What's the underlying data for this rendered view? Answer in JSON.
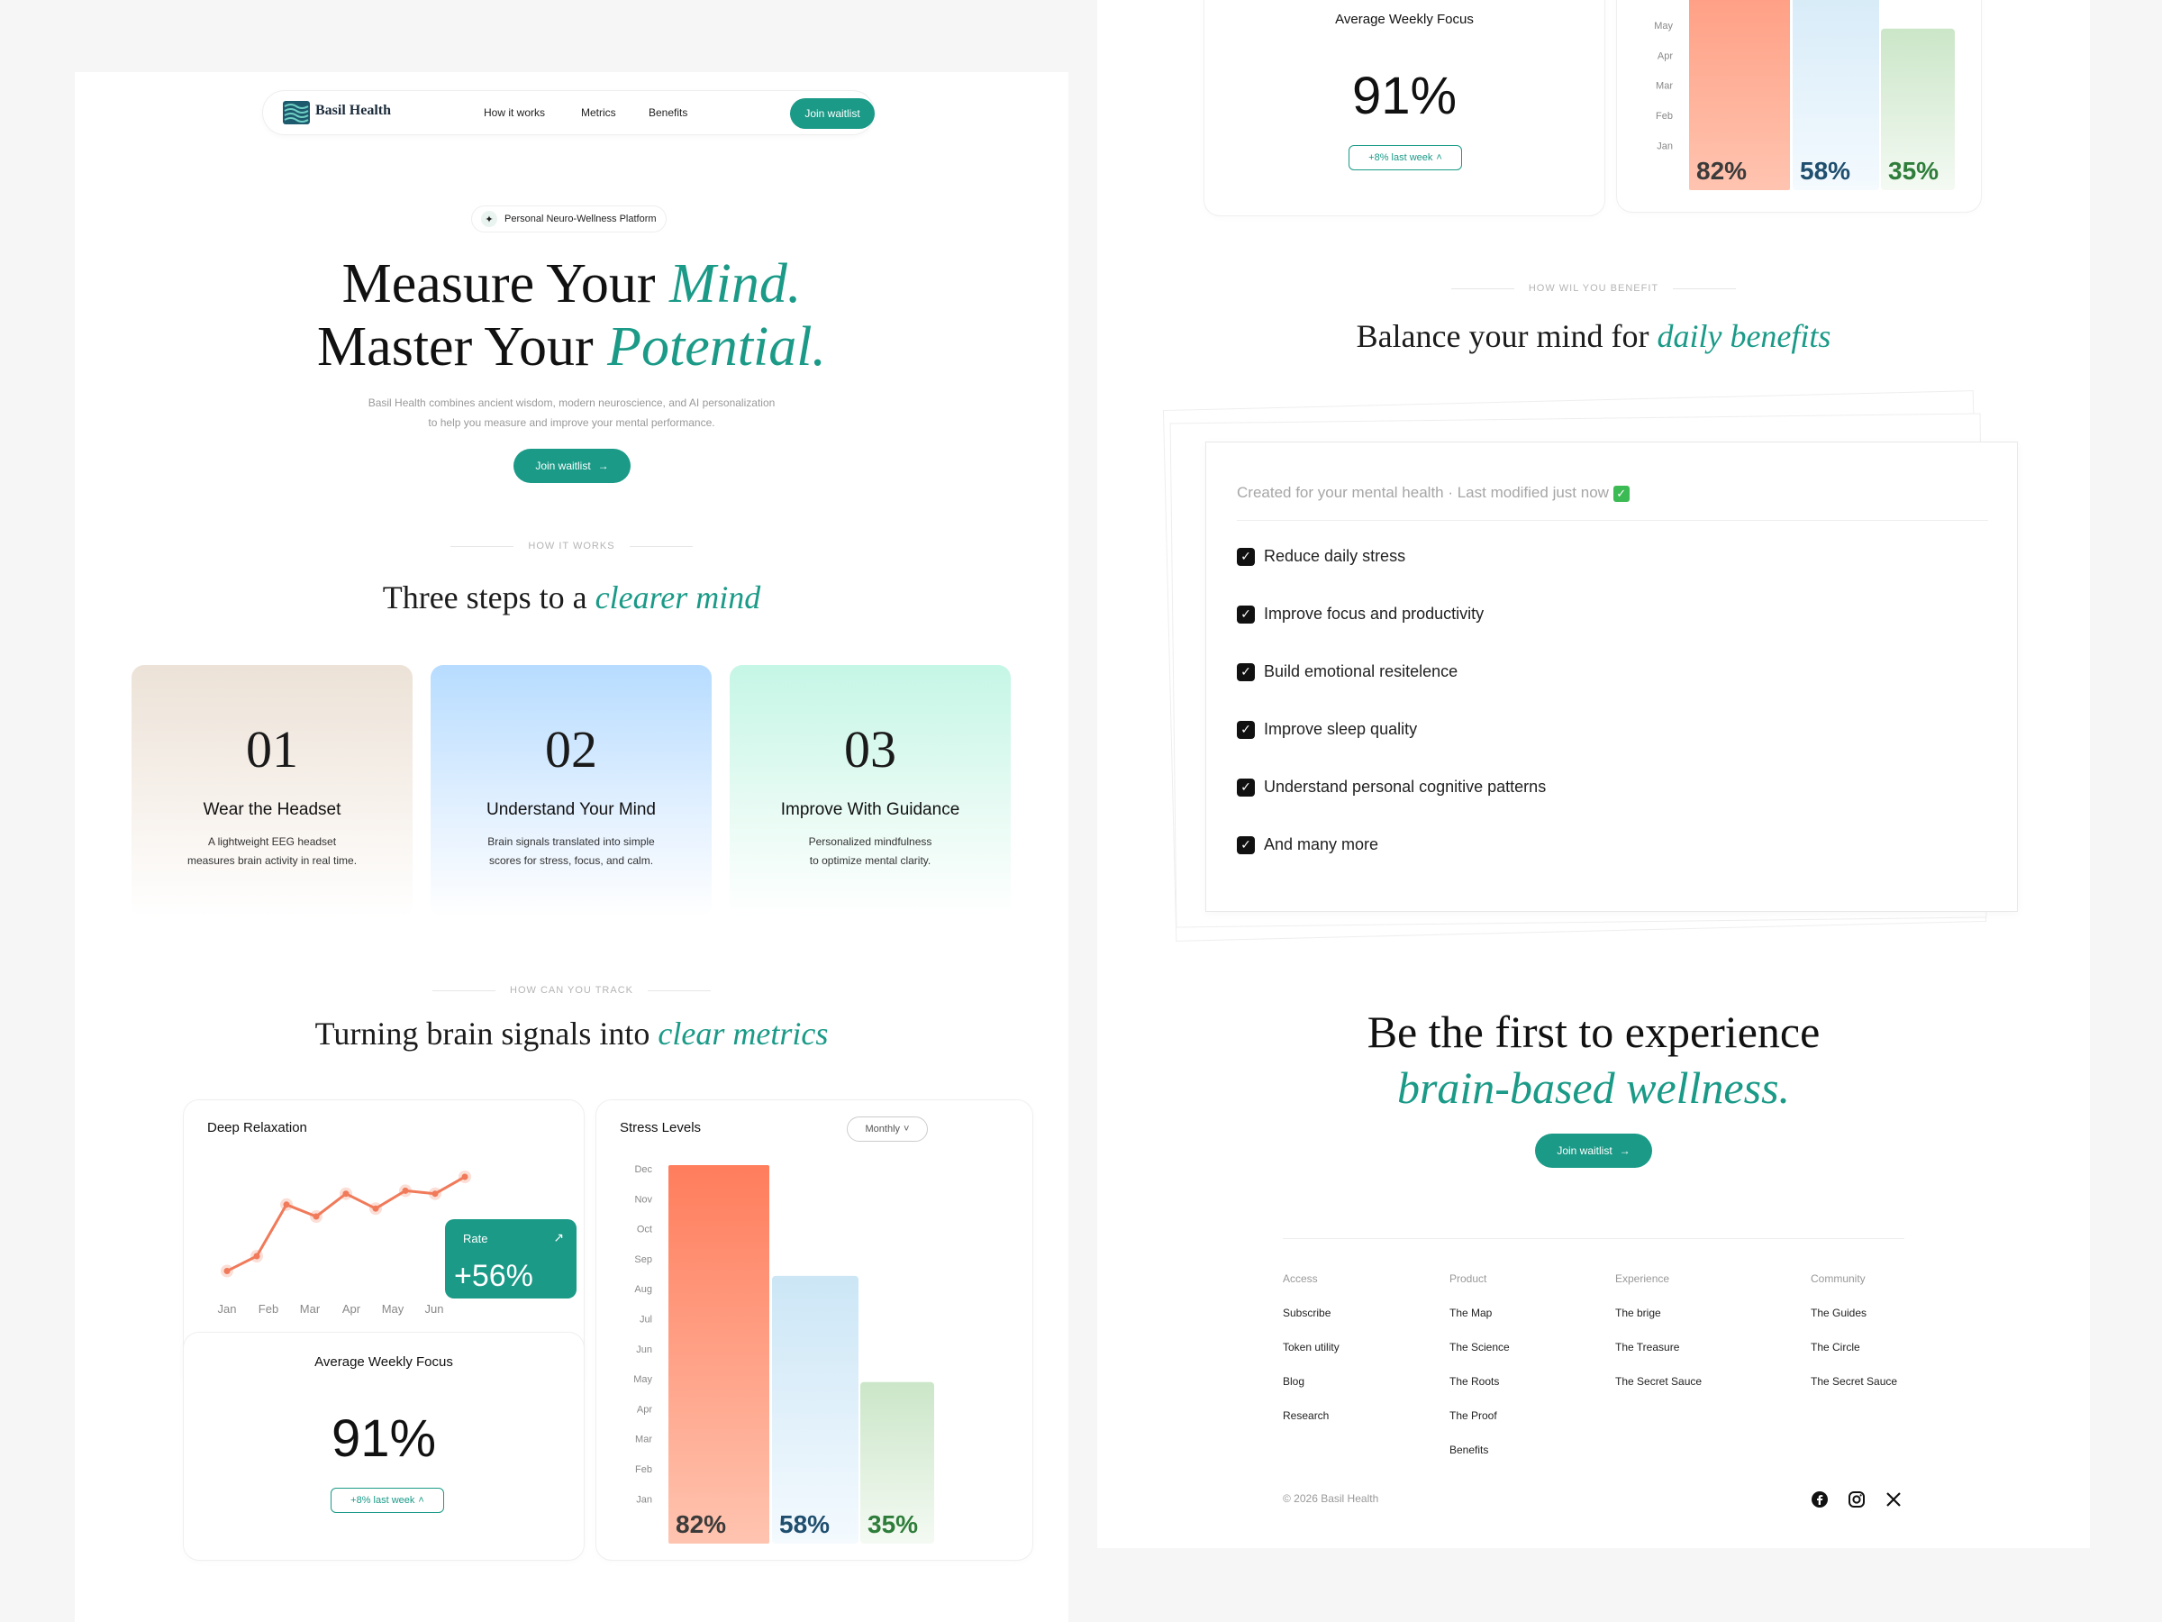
{
  "nav": {
    "brand": "Basil Health",
    "links": [
      "How it works",
      "Metrics",
      "Benefits"
    ],
    "cta": "Join waitlist"
  },
  "hero": {
    "badge": "Personal Neuro-Wellness Platform",
    "line1_a": "Measure Your",
    "line1_b": "Mind.",
    "line2_a": "Master Your",
    "line2_b": "Potential.",
    "desc1": "Basil Health combines ancient wisdom, modern neuroscience, and AI personalization",
    "desc2": "to help you measure and improve your mental performance.",
    "cta": "Join waitlist"
  },
  "how": {
    "eyebrow": "HOW IT WORKS",
    "title_a": "Three steps to a",
    "title_b": "clearer mind",
    "steps": [
      {
        "num": "01",
        "title": "Wear the Headset",
        "desc1": "A lightweight EEG headset",
        "desc2": "measures brain activity in real time."
      },
      {
        "num": "02",
        "title": "Understand Your Mind",
        "desc1": "Brain signals translated into simple",
        "desc2": "scores for stress, focus, and calm."
      },
      {
        "num": "03",
        "title": "Improve With Guidance",
        "desc1": "Personalized mindfulness",
        "desc2": "to optimize mental clarity."
      }
    ]
  },
  "track": {
    "eyebrow": "HOW CAN YOU TRACK",
    "title_a": "Turning brain signals into",
    "title_b": "clear metrics",
    "relax": {
      "title": "Deep Relaxation",
      "rate_label": "Rate",
      "rate_value": "+56%"
    },
    "focus": {
      "title": "Average Weekly Focus",
      "value": "91%",
      "delta": "+8% last week"
    },
    "stress": {
      "title": "Stress Levels",
      "select": "Monthly"
    }
  },
  "chart_data": [
    {
      "type": "line",
      "title": "Deep Relaxation",
      "x": [
        "Jan",
        "Feb",
        "Mar",
        "Apr",
        "May",
        "Jun"
      ],
      "series": [
        {
          "values": [
            5,
            20,
            72,
            60,
            83,
            68,
            86,
            83,
            100
          ]
        }
      ],
      "ylim": [
        0,
        100
      ]
    },
    {
      "type": "bar",
      "title": "Stress Levels",
      "y_ticks": [
        "Dec",
        "Nov",
        "Oct",
        "Sep",
        "Aug",
        "Jul",
        "Jun",
        "May",
        "Apr",
        "Mar",
        "Feb",
        "Jan"
      ],
      "categories": [
        "",
        "",
        ""
      ],
      "values": [
        82,
        58,
        35
      ],
      "labels": [
        "82%",
        "58%",
        "35%"
      ],
      "colors": [
        "#ff8060",
        "#bfe0f0",
        "#cfe6cc"
      ],
      "label_colors": [
        "#3b3b3b",
        "#1f4e6e",
        "#2e7d3a"
      ]
    }
  ],
  "benefit": {
    "eyebrow": "HOW WIL YOU BENEFIT",
    "title_a": "Balance your mind for",
    "title_b": "daily benefits",
    "meta": "Created for your mental health · Last modified just now",
    "items": [
      "Reduce daily stress",
      "Improve focus and productivity",
      "Build emotional resitelence",
      "Improve sleep quality",
      "Understand personal cognitive patterns",
      "And many more"
    ]
  },
  "cta": {
    "line1": "Be the first to experience",
    "line2": "brain-based wellness.",
    "button": "Join waitlist"
  },
  "footer": {
    "cols": [
      {
        "head": "Access",
        "links": [
          "Subscribe",
          "Token utility",
          "Blog",
          "Research"
        ]
      },
      {
        "head": "Product",
        "links": [
          "The Map",
          "The Science",
          "The Roots",
          "The Proof",
          "Benefits"
        ]
      },
      {
        "head": "Experience",
        "links": [
          "The brige",
          "The Treasure",
          "The Secret Sauce"
        ]
      },
      {
        "head": "Community",
        "links": [
          "The Guides",
          "The Circle",
          "The Secret Sauce"
        ]
      }
    ],
    "copyright": "© 2026 Basil Health"
  },
  "icons": {
    "social": [
      "facebook-icon",
      "instagram-icon",
      "x-icon"
    ]
  },
  "colors": {
    "accent": "#1a9a87"
  }
}
